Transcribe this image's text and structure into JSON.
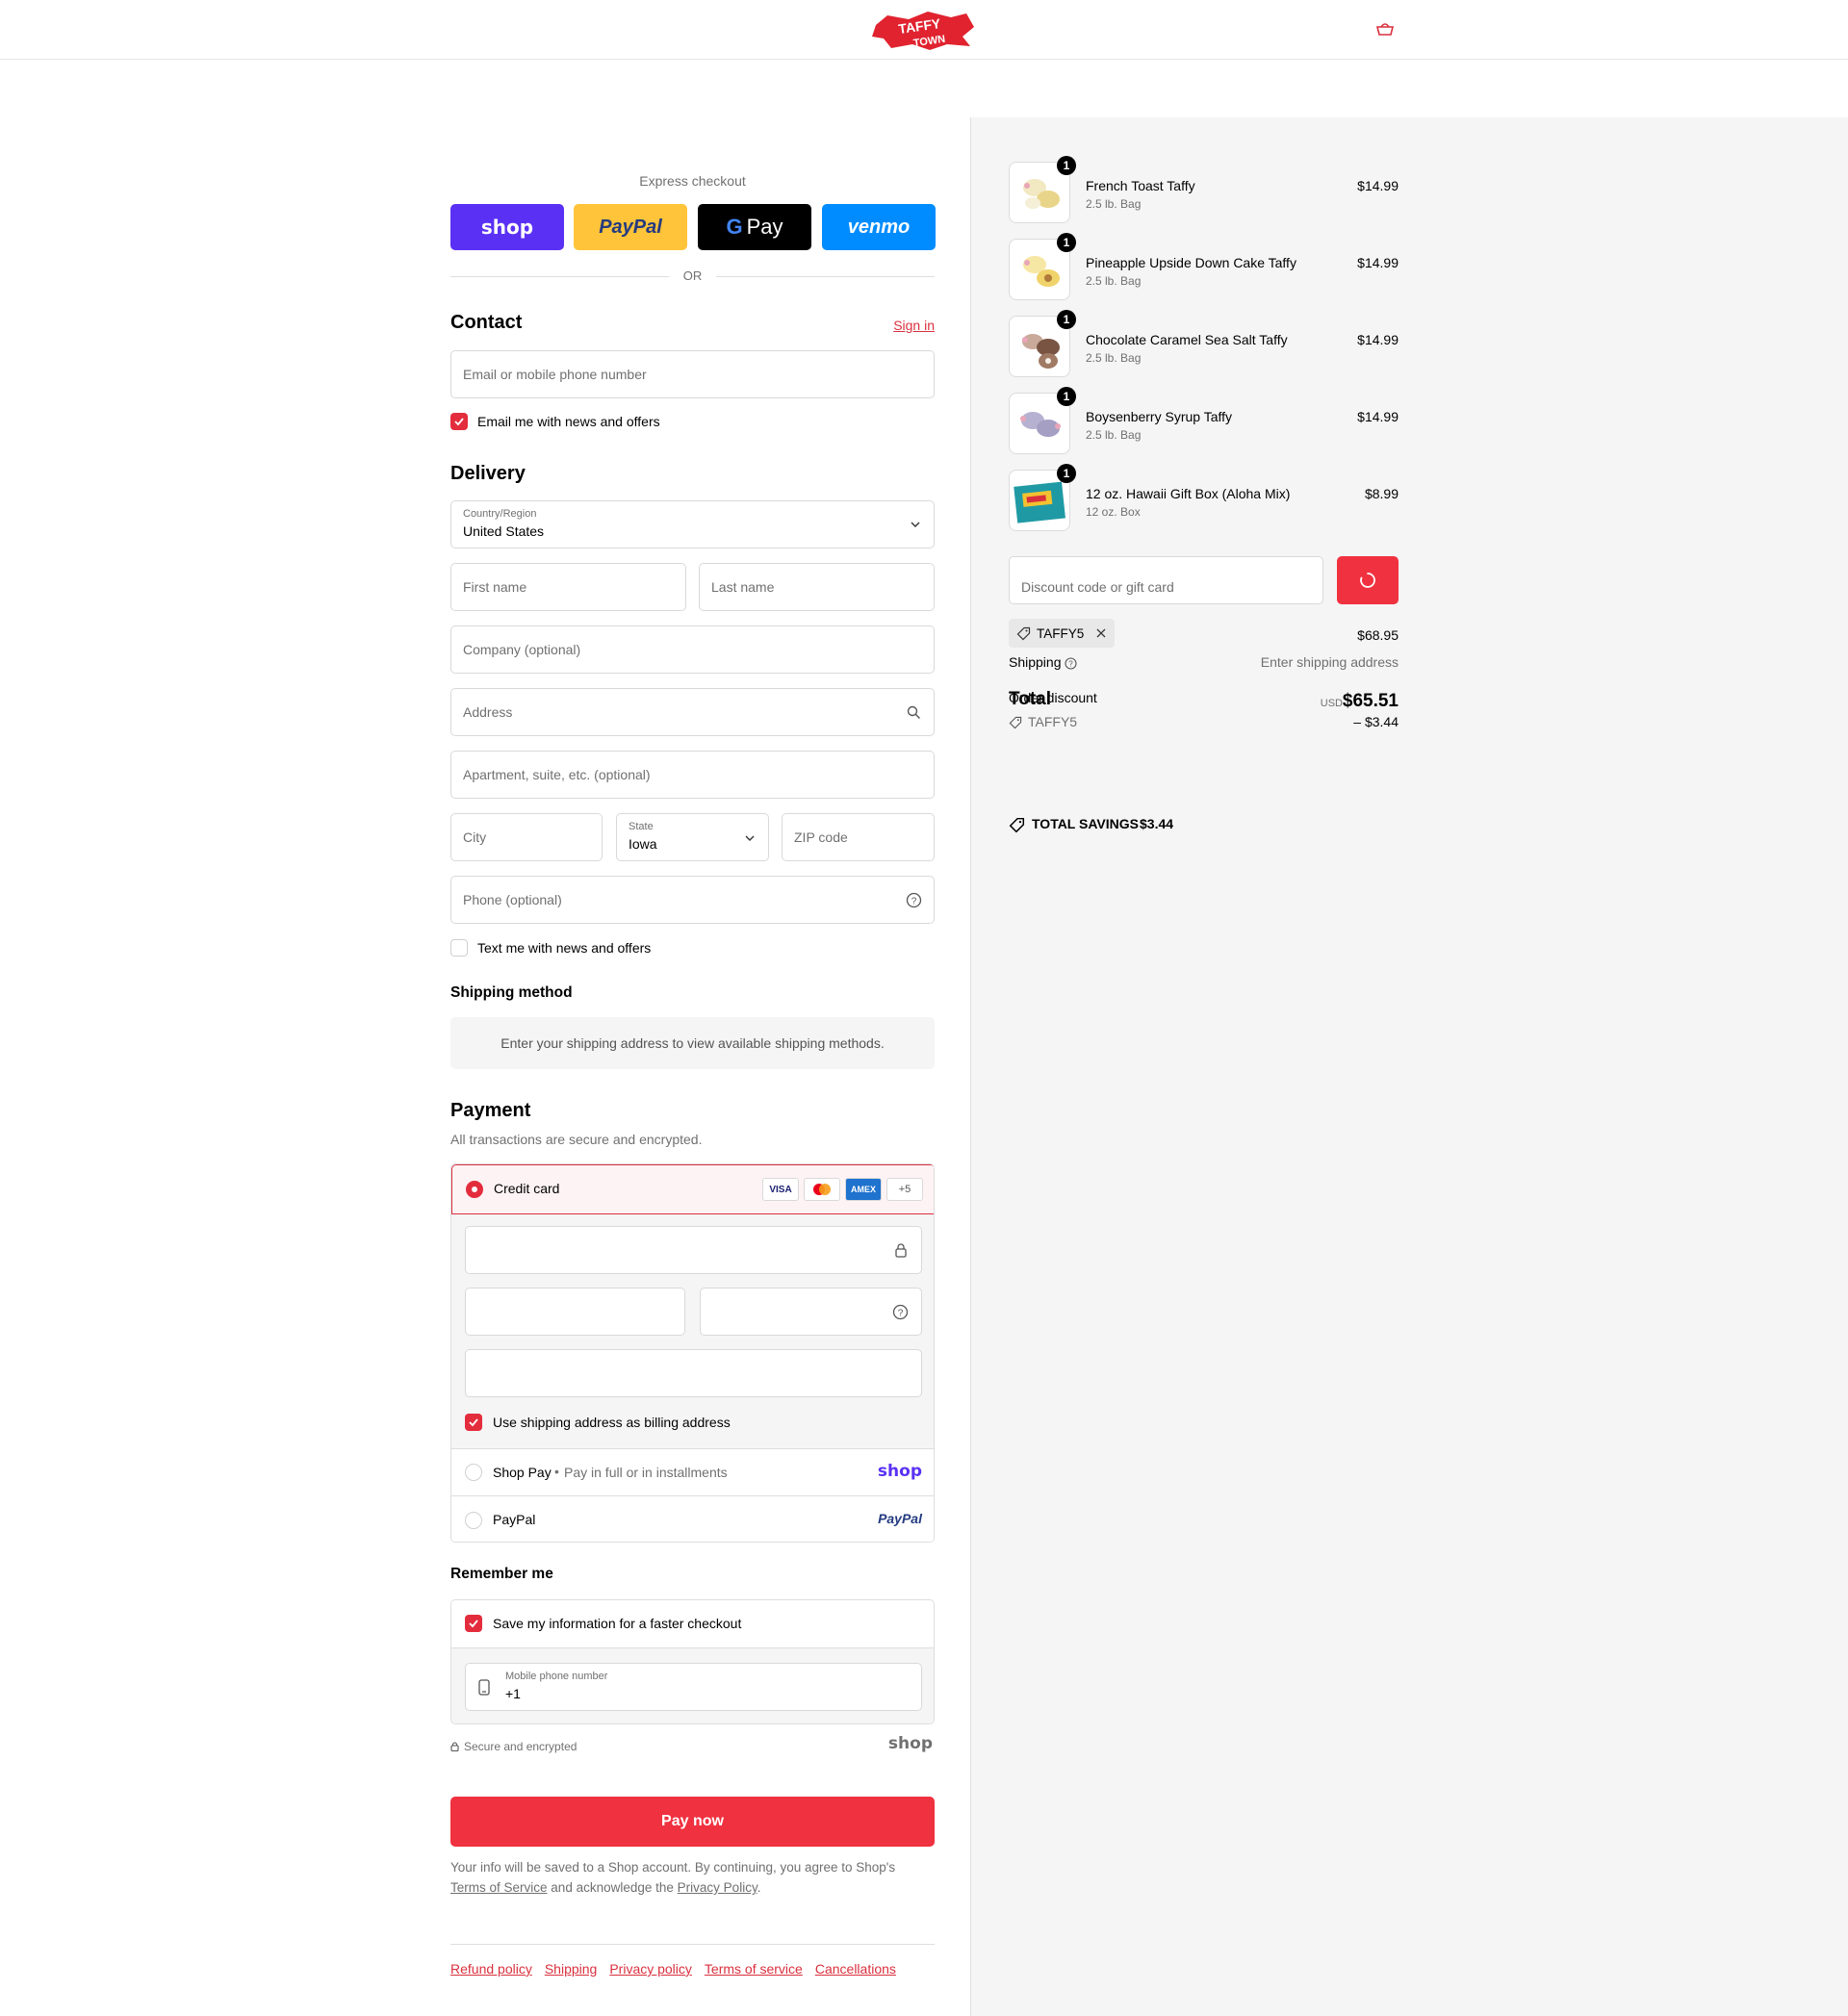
{
  "header": {
    "logo_alt": "Taffy Town",
    "cart_label": "cart"
  },
  "express": {
    "title": "Express checkout",
    "shop": "shop",
    "paypal": "PayPal",
    "gpay": "Pay",
    "venmo": "venmo",
    "or": "OR"
  },
  "contact": {
    "title": "Contact",
    "sign_in": "Sign in",
    "email_placeholder": "Email or mobile phone number",
    "email_optin": "Email me with news and offers"
  },
  "delivery": {
    "title": "Delivery",
    "country_label": "Country/Region",
    "country_value": "United States",
    "first_name": "First name",
    "last_name": "Last name",
    "company": "Company (optional)",
    "address": "Address",
    "apartment": "Apartment, suite, etc. (optional)",
    "city": "City",
    "state_label": "State",
    "state_value": "Iowa",
    "zip": "ZIP code",
    "phone": "Phone (optional)",
    "text_optin": "Text me with news and offers"
  },
  "shipping_method": {
    "title": "Shipping method",
    "notice": "Enter your shipping address to view available shipping methods."
  },
  "payment": {
    "title": "Payment",
    "subtitle": "All transactions are secure and encrypted.",
    "credit_card": "Credit card",
    "card_brands": [
      "VISA",
      "MC",
      "AMEX",
      "+5"
    ],
    "billing_same": "Use shipping address as billing address",
    "shop_pay": "Shop Pay",
    "shop_pay_desc": "Pay in full or in installments",
    "shop_pay_logo": "shop",
    "paypal": "PayPal",
    "paypal_logo": "PayPal"
  },
  "remember": {
    "title": "Remember me",
    "save_info": "Save my information for a faster checkout",
    "mobile_label": "Mobile phone number",
    "mobile_value": "+1",
    "secure": "Secure and encrypted",
    "shop_logo": "shop"
  },
  "pay_now": "Pay now",
  "legal": {
    "text1": "Your info will be saved to a Shop account. By continuing, you agree to Shop's",
    "tos": "Terms of Service",
    "text2": "and acknowledge the",
    "privacy": "Privacy Policy",
    "end": "."
  },
  "footer_links": [
    "Refund policy",
    "Shipping",
    "Privacy policy",
    "Terms of service",
    "Cancellations"
  ],
  "order": {
    "items": [
      {
        "name": "French Toast Taffy",
        "variant": "2.5 lb. Bag",
        "price": "$14.99",
        "qty": "1",
        "color": "#e9d58a"
      },
      {
        "name": "Pineapple Upside Down Cake Taffy",
        "variant": "2.5 lb. Bag",
        "price": "$14.99",
        "qty": "1",
        "color": "#f0d36b"
      },
      {
        "name": "Chocolate Caramel Sea Salt Taffy",
        "variant": "2.5 lb. Bag",
        "price": "$14.99",
        "qty": "1",
        "color": "#7a5443"
      },
      {
        "name": "Boysenberry Syrup Taffy",
        "variant": "2.5 lb. Bag",
        "price": "$14.99",
        "qty": "1",
        "color": "#a59fc3"
      },
      {
        "name": "12 oz. Hawaii Gift Box (Aloha Mix)",
        "variant": "12 oz. Box",
        "price": "$8.99",
        "qty": "1",
        "color": "#1f9aa5"
      }
    ],
    "discount_placeholder": "Discount code or gift card",
    "applied_code": "TAFFY5",
    "subtotal_value": "$68.95",
    "shipping_label": "Shipping",
    "shipping_value": "Enter shipping address",
    "total_label": "Total",
    "discount_label": "Order discount",
    "currency": "USD",
    "total_value": "$65.51",
    "discount_code": "TAFFY5",
    "discount_value": "– $3.44",
    "savings_label": "TOTAL SAVINGS",
    "savings_value": "$3.44"
  },
  "colors": {
    "accent": "#e32d3c",
    "shop_purple": "#5a31f4",
    "paypal_yellow": "#ffc439",
    "venmo_blue": "#008cff"
  }
}
